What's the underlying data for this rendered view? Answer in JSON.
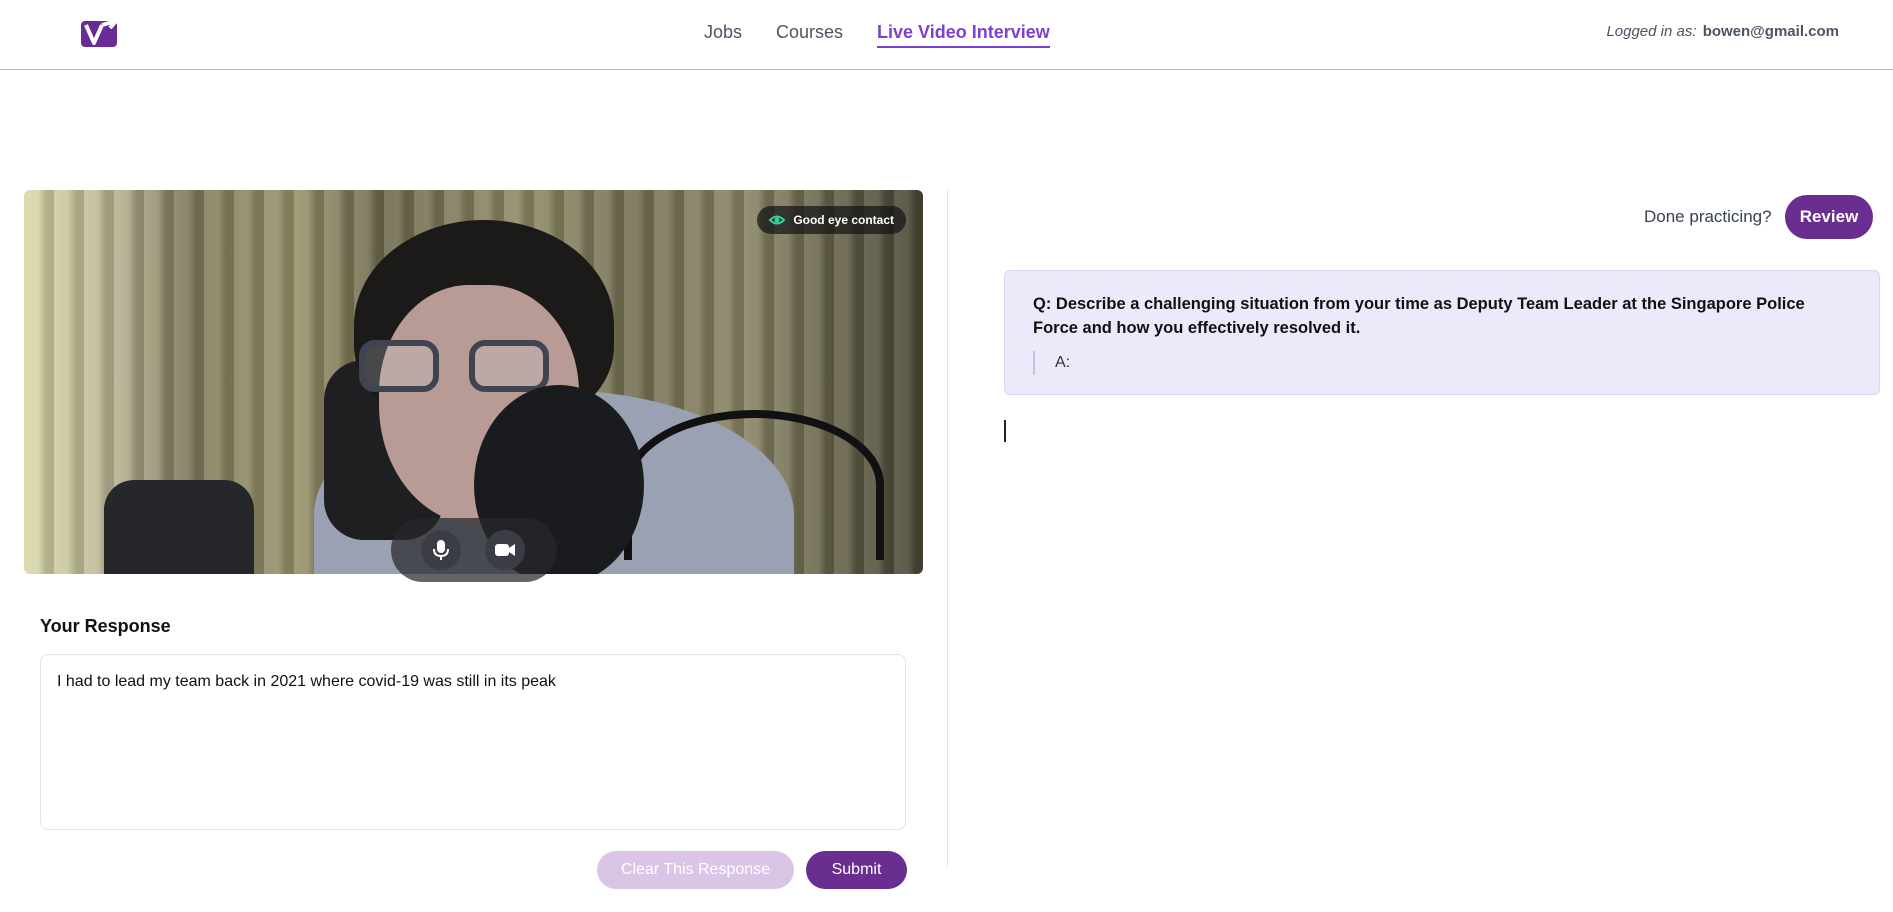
{
  "header": {
    "nav": [
      {
        "label": "Jobs"
      },
      {
        "label": "Courses"
      },
      {
        "label": "Live Video Interview",
        "active": true
      }
    ],
    "login_label": "Logged in as:",
    "login_email": "bowen@gmail.com"
  },
  "video": {
    "badge": "Good eye contact"
  },
  "response": {
    "title": "Your Response",
    "text": "I had to lead my team back in 2021 where covid-19 was still in its peak",
    "clear_label": "Clear This Response",
    "submit_label": "Submit"
  },
  "review": {
    "prompt": "Done practicing?",
    "button": "Review"
  },
  "qa": {
    "question": "Q: Describe a challenging situation from your time as Deputy Team Leader at the Singapore Police Force and how you effectively resolved it.",
    "answer": "A:"
  },
  "colors": {
    "accent": "#7e3fd6",
    "primary_button": "#6a2d90",
    "disabled_button": "#dac5e6",
    "question_card": "#ece9fb"
  }
}
